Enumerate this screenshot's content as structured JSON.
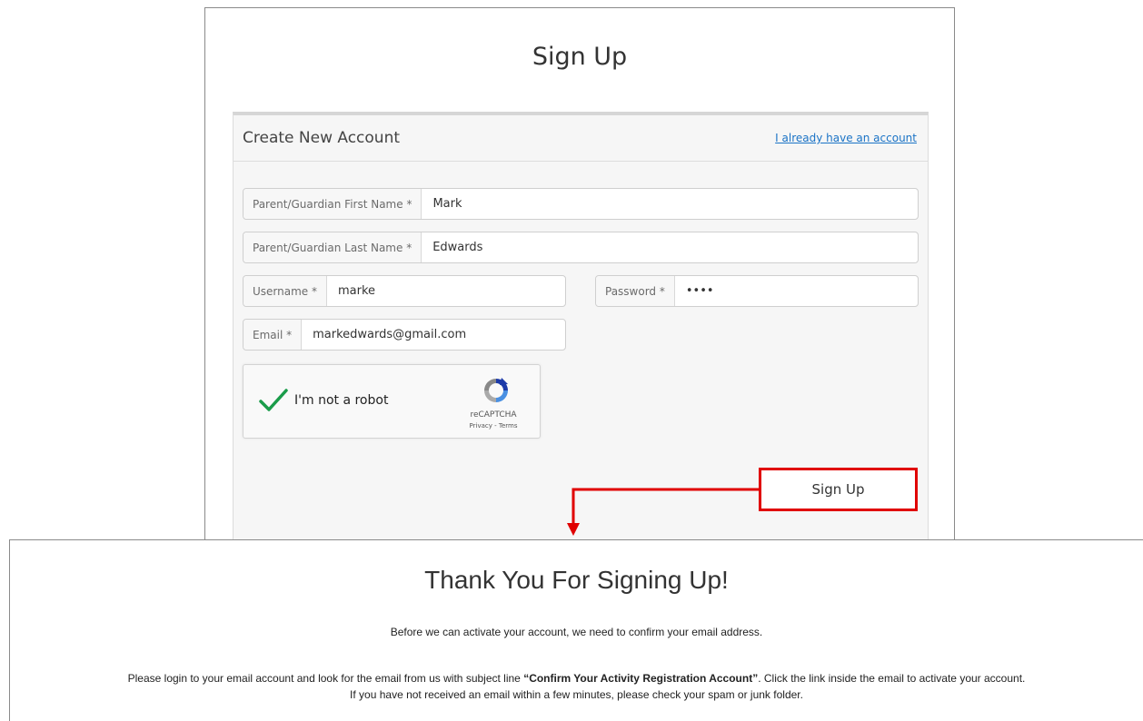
{
  "signup": {
    "title": "Sign Up",
    "panel_title": "Create New Account",
    "login_link": "I already have an account",
    "fields": {
      "first_name": {
        "label": "Parent/Guardian First Name *",
        "value": "Mark"
      },
      "last_name": {
        "label": "Parent/Guardian Last Name *",
        "value": "Edwards"
      },
      "username": {
        "label": "Username *",
        "value": "marke"
      },
      "password": {
        "label": "Password *",
        "value": "••••"
      },
      "email": {
        "label": "Email *",
        "value": "markedwards@gmail.com"
      }
    },
    "captcha": {
      "label": "I'm not a robot",
      "brand": "reCAPTCHA",
      "links": "Privacy - Terms",
      "checked": true,
      "check_color": "#1a9c4a"
    },
    "submit_label": "Sign Up"
  },
  "annotation": {
    "highlight_color": "#e00000"
  },
  "thanks": {
    "title": "Thank You For Signing Up!",
    "line1": "Before we can activate your account, we need to confirm your email address.",
    "line2_prefix": "Please login to your email account and look for the email from us with subject line ",
    "line2_subject": "“Confirm Your Activity Registration Account”",
    "line2_suffix": ". Click the link inside the email to activate your account.",
    "line3": "If you have not received an email within a few minutes, please check your spam or junk folder."
  }
}
